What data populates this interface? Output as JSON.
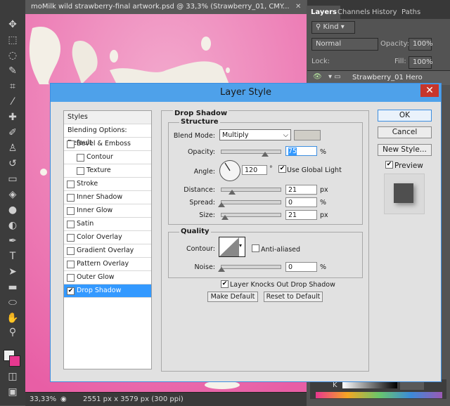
{
  "document": {
    "tab_title": "moMilk wild strawberry-final artwork.psd @ 33,3% (Strawberry_01, CMY...",
    "zoom": "33,33%",
    "size_info": "2551 px x 3579 px (300 ppi)"
  },
  "panel": {
    "tabs": [
      "Layers",
      "Channels",
      "History",
      "Paths"
    ],
    "kind_label": "Kind",
    "blend_mode": "Normal",
    "opacity_label": "Opacity:",
    "opacity_value": "100%",
    "lock_label": "Lock:",
    "fill_label": "Fill:",
    "fill_value": "100%",
    "layer_name": "Strawberry_01 Hero",
    "color_k": "K"
  },
  "dialog": {
    "title": "Layer Style",
    "styles_header": "Styles",
    "blending_options": "Blending Options: Default",
    "style_items": [
      {
        "label": "Bevel & Emboss",
        "checked": false
      },
      {
        "label": "Contour",
        "checked": false
      },
      {
        "label": "Texture",
        "checked": false
      },
      {
        "label": "Stroke",
        "checked": false
      },
      {
        "label": "Inner Shadow",
        "checked": false
      },
      {
        "label": "Inner Glow",
        "checked": false
      },
      {
        "label": "Satin",
        "checked": false
      },
      {
        "label": "Color Overlay",
        "checked": false
      },
      {
        "label": "Gradient Overlay",
        "checked": false
      },
      {
        "label": "Pattern Overlay",
        "checked": false
      },
      {
        "label": "Outer Glow",
        "checked": false
      },
      {
        "label": "Drop Shadow",
        "checked": true,
        "selected": true
      }
    ],
    "section_title": "Drop Shadow",
    "structure_title": "Structure",
    "blend_mode_label": "Blend Mode:",
    "blend_mode_value": "Multiply",
    "opacity_label": "Opacity:",
    "opacity_value": "75",
    "opacity_level": 0.75,
    "angle_label": "Angle:",
    "angle_value": "120",
    "angle_unit": "°",
    "use_global_light": "Use Global Light",
    "use_global_light_checked": true,
    "distance_label": "Distance:",
    "distance_value": "21",
    "spread_label": "Spread:",
    "spread_value": "0",
    "size_label": "Size:",
    "size_value": "21",
    "unit_px": "px",
    "unit_pct": "%",
    "quality_title": "Quality",
    "contour_label": "Contour:",
    "anti_aliased": "Anti-aliased",
    "noise_label": "Noise:",
    "noise_value": "0",
    "knocks_out": "Layer Knocks Out Drop Shadow",
    "knocks_out_checked": true,
    "make_default": "Make Default",
    "reset_default": "Reset to Default",
    "ok": "OK",
    "cancel": "Cancel",
    "new_style": "New Style...",
    "preview": "Preview",
    "preview_checked": true,
    "colors": {
      "title_bar": "#4ea1ea",
      "close": "#c7362c",
      "selection": "#3399ff",
      "canvas": "#ea66aa",
      "shadow_swatch": "#cfcdc6"
    }
  }
}
